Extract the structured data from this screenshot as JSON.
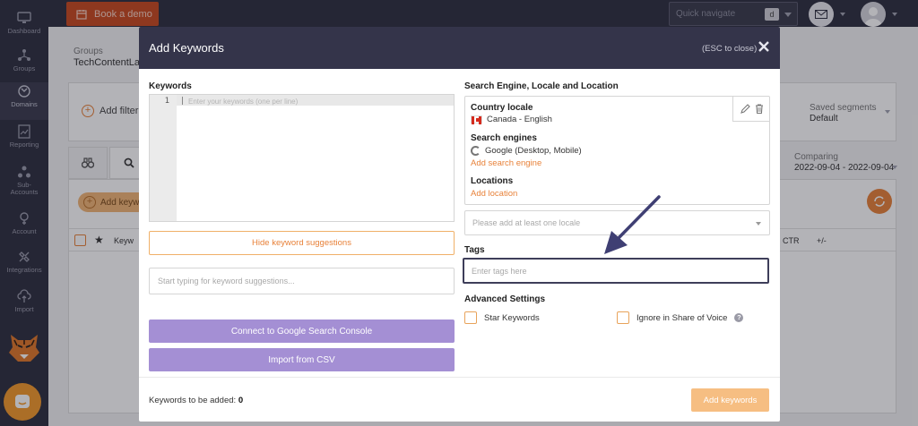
{
  "sidebar": {
    "items": [
      {
        "label": "Dashboard",
        "icon": "monitor-icon"
      },
      {
        "label": "Groups",
        "icon": "groups-icon"
      },
      {
        "label": "Domains",
        "icon": "domains-icon"
      },
      {
        "label": "Reporting",
        "icon": "reporting-icon"
      },
      {
        "label": "Sub-Accounts",
        "icon": "sub-accounts-icon"
      },
      {
        "label": "Account",
        "icon": "account-icon"
      },
      {
        "label": "Integrations",
        "icon": "integrations-icon"
      },
      {
        "label": "Import",
        "icon": "import-icon"
      }
    ]
  },
  "topbar": {
    "demo_label": "Book a demo",
    "quick_nav_placeholder": "Quick navigate",
    "quick_nav_key": "d"
  },
  "background": {
    "groups_label": "Groups",
    "groups_value": "TechContentLab",
    "add_filter": "Add filter",
    "saved_segments_label": "Saved segments",
    "saved_segments_value": "Default",
    "comparing_label": "Comparing",
    "comparing_value": "2022-09-04 - 2022-09-04",
    "add_keywords_btn": "Add keyw",
    "col_keyword": "Keyw",
    "col_ctr": "CTR",
    "col_change": "+/-"
  },
  "modal": {
    "title": "Add Keywords",
    "close_hint": "(ESC to close)",
    "keywords_label": "Keywords",
    "editor_line": "1",
    "editor_placeholder": "Enter your keywords (one per line)",
    "hide_suggestions": "Hide keyword suggestions",
    "suggestions_placeholder": "Start typing for keyword suggestions...",
    "connect_gsc": "Connect to Google Search Console",
    "import_csv": "Import from CSV",
    "se_section_label": "Search Engine, Locale and Location",
    "country_locale_label": "Country locale",
    "country_locale_value": "Canada - English",
    "search_engines_label": "Search engines",
    "search_engines_value": "Google (Desktop, Mobile)",
    "add_search_engine": "Add search engine",
    "locations_label": "Locations",
    "add_location": "Add location",
    "locale_select_placeholder": "Please add at least one locale",
    "tags_label": "Tags",
    "tags_placeholder": "Enter tags here",
    "advanced_label": "Advanced Settings",
    "star_keywords": "Star Keywords",
    "ignore_sov": "Ignore in Share of Voice",
    "count_label": "Keywords to be added:",
    "count_value": "0",
    "add_button": "Add keywords"
  },
  "colors": {
    "sidebar_bg": "#2f3040",
    "accent_orange": "#e8823a",
    "modal_header": "#34344a",
    "purple_button": "#a48fd4"
  }
}
